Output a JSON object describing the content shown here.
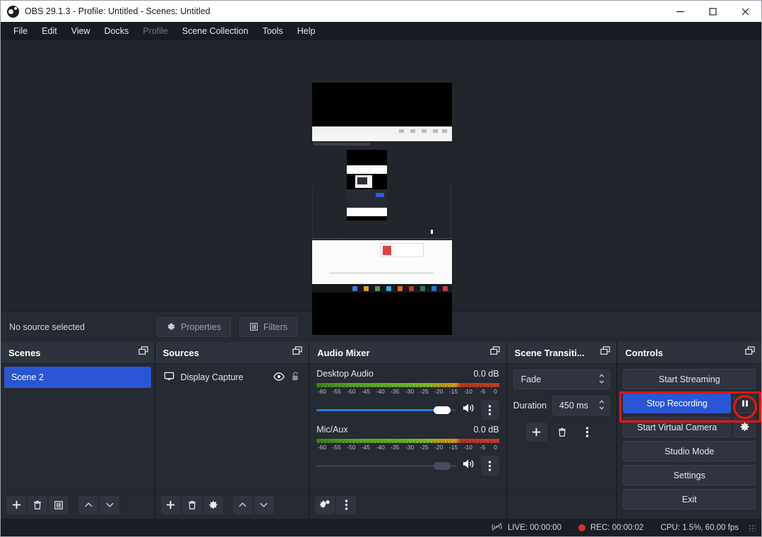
{
  "window": {
    "title": "OBS 29.1.3 - Profile: Untitled - Scenes: Untitled",
    "logo_icon": "obs-logo-icon",
    "minimize_icon": "minimize-icon",
    "maximize_icon": "maximize-icon",
    "close_icon": "close-icon"
  },
  "menubar": {
    "items": [
      {
        "label": "File",
        "enabled": true
      },
      {
        "label": "Edit",
        "enabled": true
      },
      {
        "label": "View",
        "enabled": true
      },
      {
        "label": "Docks",
        "enabled": true
      },
      {
        "label": "Profile",
        "enabled": false
      },
      {
        "label": "Scene Collection",
        "enabled": true
      },
      {
        "label": "Tools",
        "enabled": true
      },
      {
        "label": "Help",
        "enabled": true
      }
    ]
  },
  "source_actions": {
    "status": "No source selected",
    "properties_label": "Properties",
    "properties_icon": "gear-icon",
    "filters_label": "Filters",
    "filters_icon": "filters-icon"
  },
  "scenes": {
    "title": "Scenes",
    "float_icon": "undock-icon",
    "items": [
      {
        "label": "Scene 2",
        "selected": true
      }
    ],
    "toolbar": [
      {
        "name": "add-scene-button",
        "icon": "plus-icon"
      },
      {
        "name": "remove-scene-button",
        "icon": "trash-icon"
      },
      {
        "name": "scene-filters-button",
        "icon": "filters-icon"
      },
      {
        "name": "move-scene-up-button",
        "icon": "chevron-up-icon"
      },
      {
        "name": "move-scene-down-button",
        "icon": "chevron-down-icon"
      }
    ]
  },
  "sources": {
    "title": "Sources",
    "float_icon": "undock-icon",
    "items": [
      {
        "label": "Display Capture",
        "type_icon": "monitor-icon",
        "visible_icon": "eye-icon",
        "lock_icon": "unlock-icon"
      }
    ],
    "toolbar": [
      {
        "name": "add-source-button",
        "icon": "plus-icon"
      },
      {
        "name": "remove-source-button",
        "icon": "trash-icon"
      },
      {
        "name": "source-properties-button",
        "icon": "gear-icon"
      },
      {
        "name": "move-source-up-button",
        "icon": "chevron-up-icon"
      },
      {
        "name": "move-source-down-button",
        "icon": "chevron-down-icon"
      }
    ]
  },
  "audio_mixer": {
    "title": "Audio Mixer",
    "float_icon": "undock-icon",
    "scale_ticks": [
      "-60",
      "-55",
      "-50",
      "-45",
      "-40",
      "-35",
      "-30",
      "-25",
      "-20",
      "-15",
      "-10",
      "-5",
      "0"
    ],
    "tracks": [
      {
        "name": "Desktop Audio",
        "db": "0.0 dB",
        "volume_percent": 96,
        "muted": false,
        "mute_icon": "speaker-on-icon",
        "menu_icon": "vertical-dots-icon"
      },
      {
        "name": "Mic/Aux",
        "db": "0.0 dB",
        "volume_percent": 96,
        "muted": true,
        "mute_icon": "speaker-on-icon",
        "menu_icon": "vertical-dots-icon"
      }
    ],
    "toolbar": [
      {
        "name": "audio-advanced-properties-button",
        "icon": "gears-icon"
      },
      {
        "name": "audio-mixer-menu-button",
        "icon": "vertical-dots-icon"
      }
    ]
  },
  "scene_transitions": {
    "title": "Scene Transiti...",
    "float_icon": "undock-icon",
    "transition": "Fade",
    "transition_spinner_icon": "spinner-arrows-icon",
    "duration_label": "Duration",
    "duration_value": "450 ms",
    "duration_spinner_icon": "spinner-arrows-icon",
    "toolbar": [
      {
        "name": "add-transition-button",
        "icon": "plus-icon"
      },
      {
        "name": "remove-transition-button",
        "icon": "trash-icon"
      },
      {
        "name": "transition-menu-button",
        "icon": "vertical-dots-icon"
      }
    ]
  },
  "controls": {
    "title": "Controls",
    "float_icon": "undock-icon",
    "start_streaming": "Start Streaming",
    "stop_recording": "Stop Recording",
    "pause_icon": "pause-icon",
    "start_virtual_camera": "Start Virtual Camera",
    "virtual_camera_settings_icon": "gear-icon",
    "studio_mode": "Studio Mode",
    "settings": "Settings",
    "exit": "Exit",
    "highlight_color": "#f41212",
    "primary_color": "#2a55d4"
  },
  "statusbar": {
    "live_icon": "stream-off-icon",
    "live_label": "LIVE: 00:00:00",
    "rec_icon": "record-dot-icon",
    "rec_label": "REC: 00:00:02",
    "performance": "CPU: 1.5%, 60.00 fps",
    "grip_icon": "resize-grip-icon"
  }
}
